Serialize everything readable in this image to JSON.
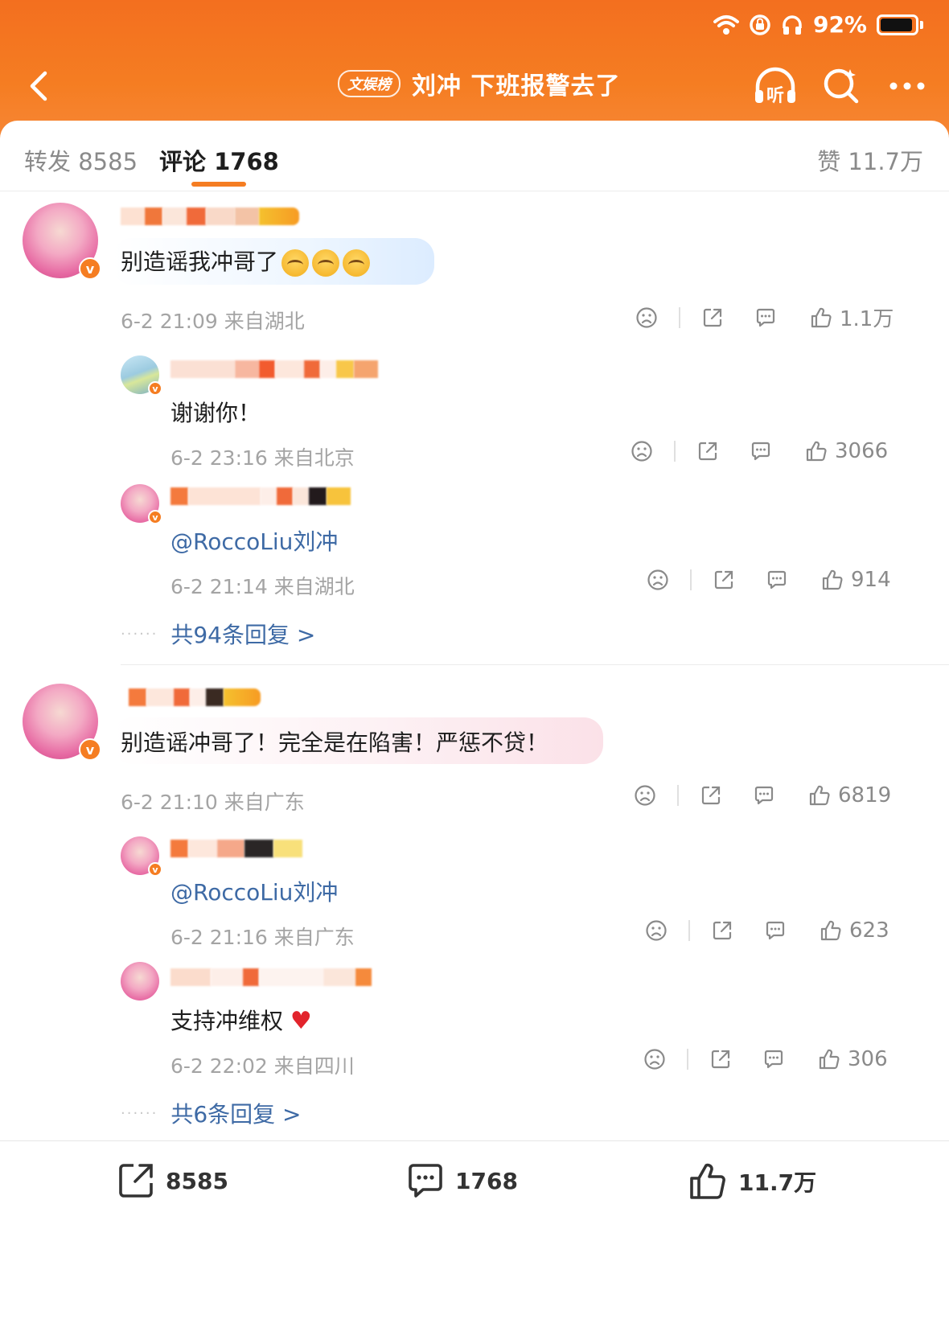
{
  "status_bar": {
    "battery_text": "92%",
    "battery_level": 0.92
  },
  "header": {
    "badge": "文娱榜",
    "title": "刘冲 下班报警去了",
    "listen_label": "听"
  },
  "tabs": {
    "repost": "转发 8585",
    "comments": "评论 1768",
    "likes": "赞 11.7万"
  },
  "comments": [
    {
      "text": "别造谣我冲哥了",
      "meta": "6-2 21:09 来自湖北",
      "likes": "1.1万",
      "replies": [
        {
          "text": "谢谢你！",
          "meta": "6-2 23:16 来自北京",
          "likes": "3066"
        },
        {
          "mention": "@RoccoLiu",
          "text_after": "刘冲",
          "meta": "6-2 21:14 来自湖北",
          "likes": "914"
        }
      ],
      "more_replies": "共94条回复 >"
    },
    {
      "text": "别造谣冲哥了！完全是在陷害！严惩不贷！",
      "meta": "6-2 21:10 来自广东",
      "likes": "6819",
      "replies": [
        {
          "mention": "@RoccoLiu",
          "text_after": "刘冲",
          "meta": "6-2 21:16 来自广东",
          "likes": "623"
        },
        {
          "text": "支持冲维权",
          "meta": "6-2 22:02 来自四川",
          "likes": "306"
        }
      ],
      "more_replies": "共6条回复 >"
    }
  ],
  "bottom_bar": {
    "reposts": "8585",
    "comments": "1768",
    "likes": "11.7万"
  },
  "colors": {
    "accent": "#f57d22",
    "link": "#3e6aa5",
    "meta": "#a4a4a4"
  }
}
